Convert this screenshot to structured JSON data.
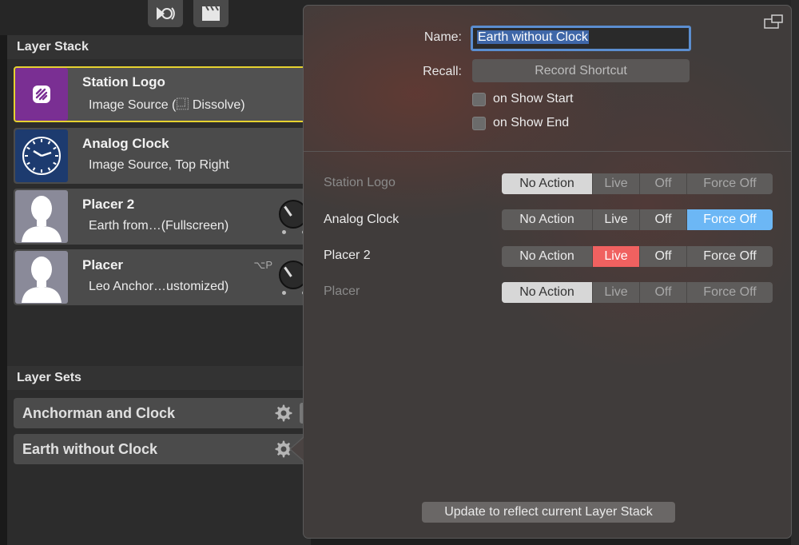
{
  "layer_stack": {
    "title": "Layer Stack",
    "layers": [
      {
        "name": "Station Logo",
        "subtitle": "Image Source (⿽ Dissolve)",
        "icon": "station-logo-icon"
      },
      {
        "name": "Analog Clock",
        "subtitle": "Image Source, Top Right",
        "icon": "clock-icon"
      },
      {
        "name": "Placer 2",
        "subtitle": "Earth from…(Fullscreen)",
        "icon": "person-silhouette-icon"
      },
      {
        "name": "Placer",
        "subtitle": "Leo Anchor…ustomized)",
        "shortcut": "⌥P",
        "icon": "person-silhouette-icon"
      }
    ]
  },
  "layer_sets": {
    "title": "Layer Sets",
    "items": [
      {
        "name": "Anchorman and Clock"
      },
      {
        "name": "Earth without Clock"
      }
    ]
  },
  "popover": {
    "name_label": "Name:",
    "name_value": "Earth without Clock",
    "recall_label": "Recall:",
    "record_shortcut": "Record Shortcut",
    "on_show_start": "on Show Start",
    "on_show_end": "on Show End",
    "options": [
      "No Action",
      "Live",
      "Off",
      "Force Off"
    ],
    "actions": [
      {
        "layer": "Station Logo",
        "selected": "No Action",
        "enabled": false
      },
      {
        "layer": "Analog Clock",
        "selected": "Force Off",
        "enabled": true
      },
      {
        "layer": "Placer 2",
        "selected": "Live",
        "enabled": true
      },
      {
        "layer": "Placer",
        "selected": "No Action",
        "enabled": false
      }
    ],
    "update_button": "Update to reflect current Layer Stack"
  },
  "colors": {
    "selection": "#e6d230",
    "live": "#f06160",
    "force_off": "#6cb7f5",
    "input_focus": "#5b8ed0"
  }
}
